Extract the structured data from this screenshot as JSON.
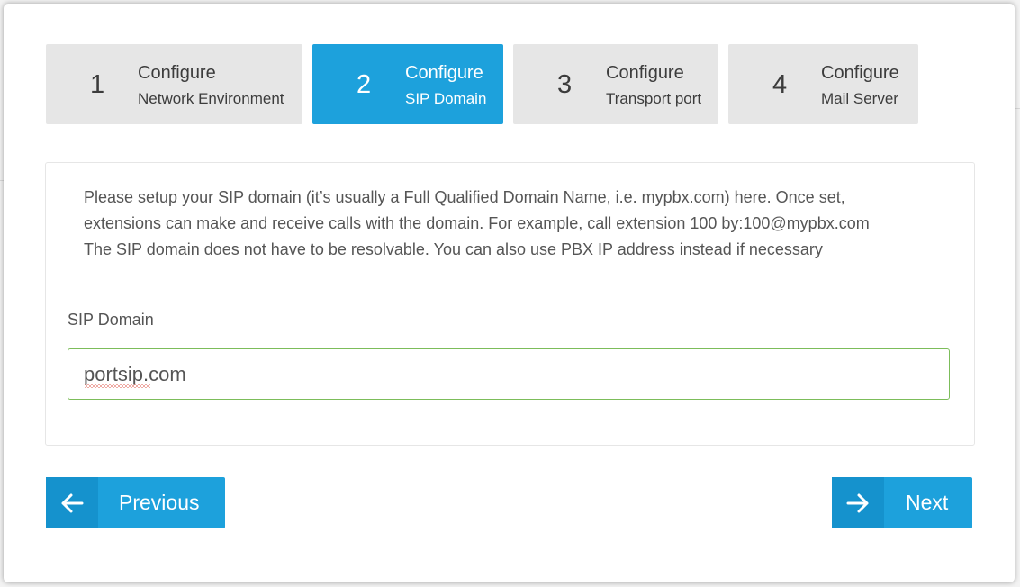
{
  "wizard": {
    "steps": [
      {
        "number": "1",
        "title": "Configure",
        "subtitle": "Network Environment",
        "active": false
      },
      {
        "number": "2",
        "title": "Configure",
        "subtitle": "SIP Domain",
        "active": true
      },
      {
        "number": "3",
        "title": "Configure",
        "subtitle": "Transport port",
        "active": false
      },
      {
        "number": "4",
        "title": "Configure",
        "subtitle": "Mail Server",
        "active": false
      }
    ]
  },
  "panel": {
    "description_lines": [
      "Please setup your SIP domain (it’s usually a Full Qualified Domain Name, i.e. mypbx.com) here. Once set,",
      "extensions can make and receive calls with the domain. For example, call extension 100 by:100@mypbx.com",
      "The SIP domain does not have to be resolvable. You can also use PBX IP address instead if necessary"
    ],
    "sip_domain_label": "SIP Domain",
    "sip_domain_value": "portsip.com"
  },
  "footer": {
    "previous_label": "Previous",
    "next_label": "Next"
  },
  "colors": {
    "accent": "#1da1dc",
    "accent_dark": "#1592cd",
    "inactive_step": "#e6e6e6",
    "field_border_valid": "#7cbd5a"
  },
  "icons": {
    "previous": "arrow-left-icon",
    "next": "arrow-right-icon"
  }
}
